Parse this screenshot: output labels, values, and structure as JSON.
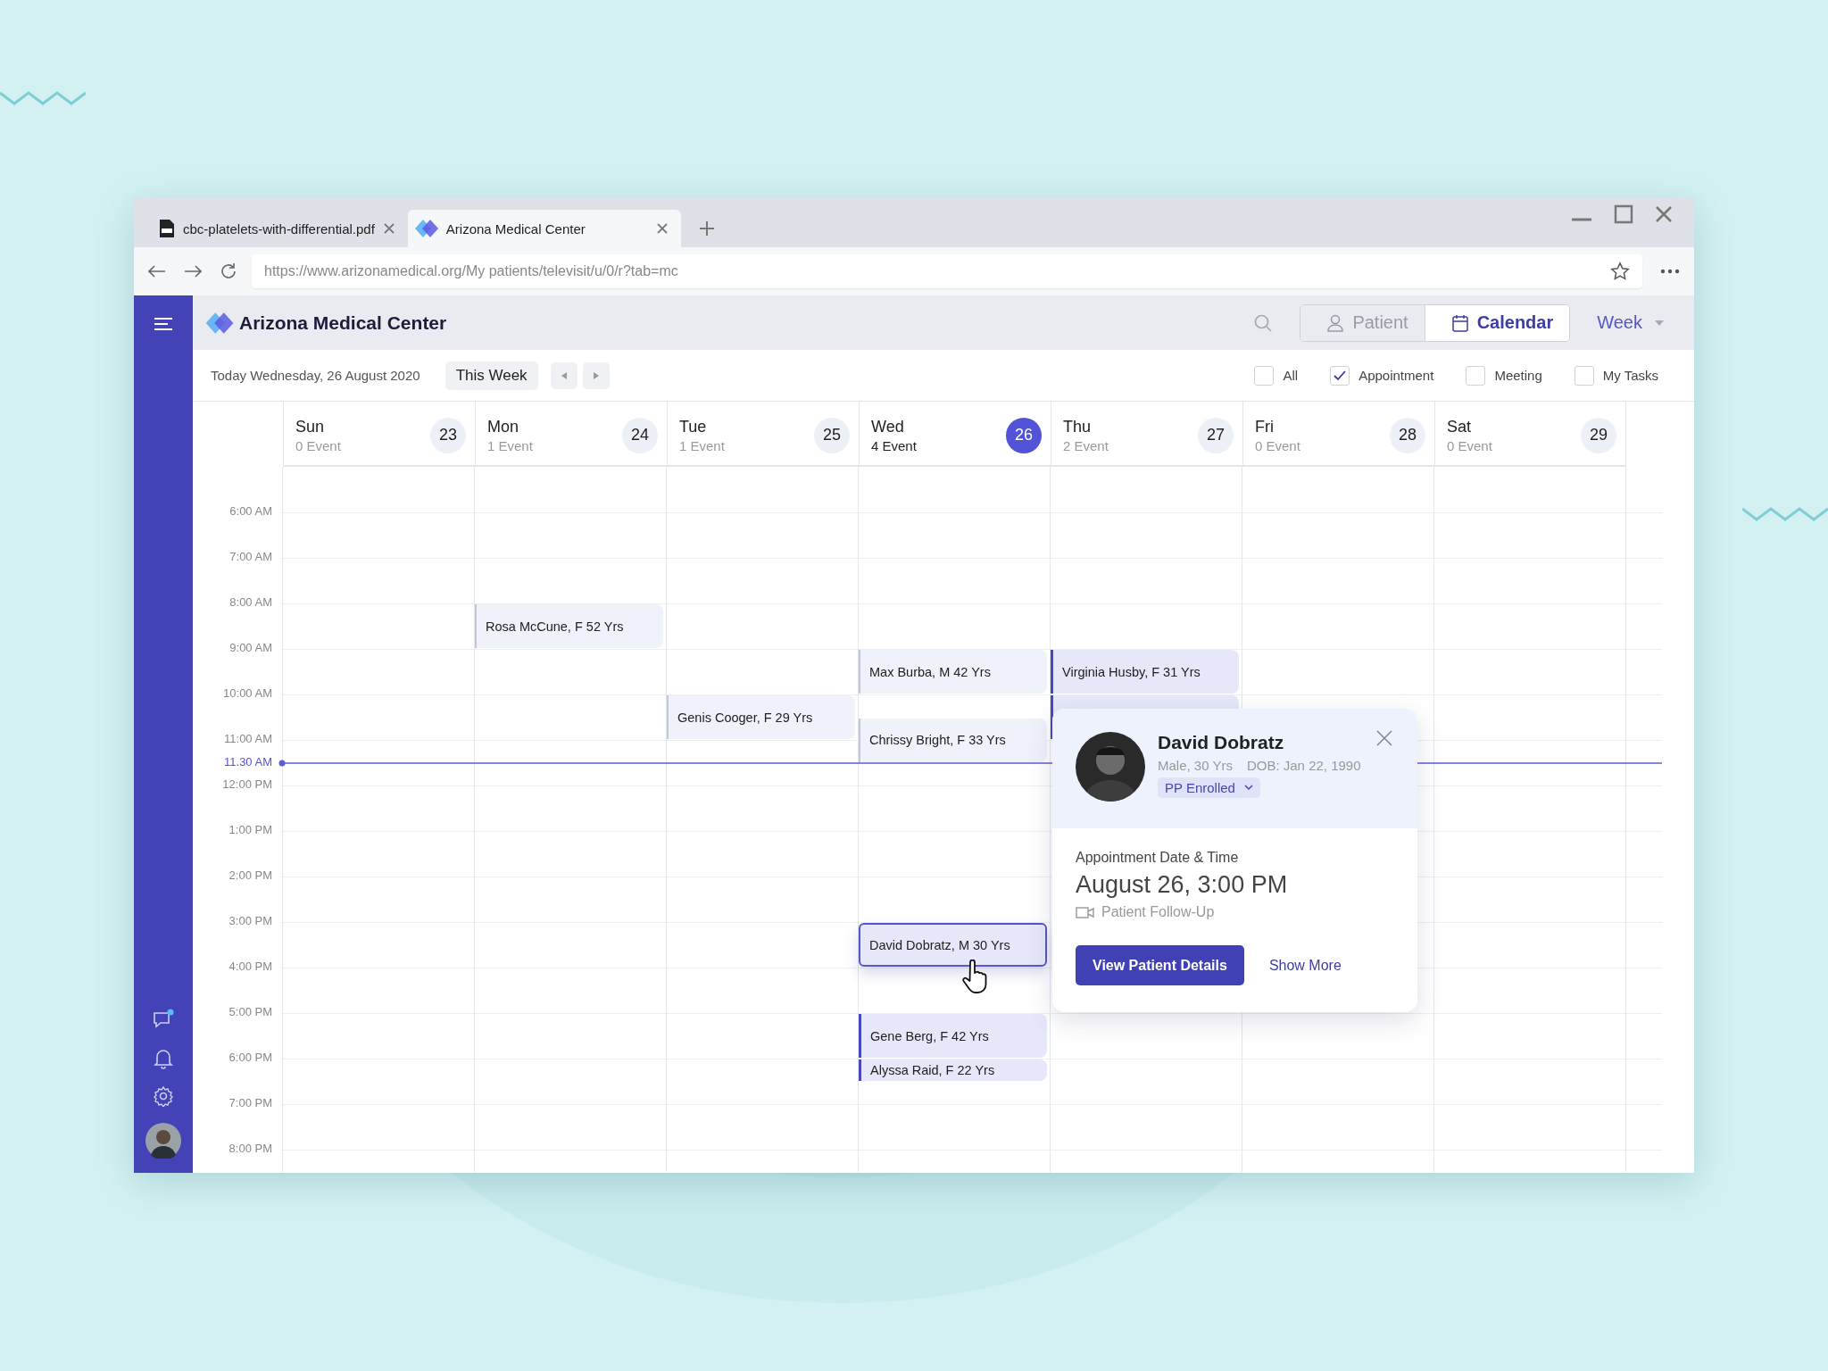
{
  "browser": {
    "tabs": [
      {
        "title": "cbc-platelets-with-differential.pdf",
        "kind": "pdf",
        "selected": false
      },
      {
        "title": "Arizona Medical Center",
        "kind": "site",
        "selected": true
      }
    ],
    "url": "https://www.arizonamedical.org/My patients/televisit/u/0/r?tab=mc"
  },
  "app": {
    "title": "Arizona Medical Center",
    "views": [
      {
        "label": "Patient",
        "kind": "person",
        "selected": false
      },
      {
        "label": "Calendar",
        "kind": "calendar",
        "selected": true
      }
    ],
    "range": "Week"
  },
  "sidebar": {
    "unread_messages": true
  },
  "toolbar": {
    "today": "Today Wednesday, 26 August 2020",
    "this_week": "This Week",
    "filters": [
      {
        "label": "All",
        "checked": false
      },
      {
        "label": "Appointment",
        "checked": true
      },
      {
        "label": "Meeting",
        "checked": false
      },
      {
        "label": "My Tasks",
        "checked": false
      }
    ]
  },
  "days": [
    {
      "name": "Sun",
      "count": "0 Event",
      "date": "23",
      "today": false
    },
    {
      "name": "Mon",
      "count": "1 Event",
      "date": "24",
      "today": false
    },
    {
      "name": "Tue",
      "count": "1 Event",
      "date": "25",
      "today": false
    },
    {
      "name": "Wed",
      "count": "4 Event",
      "date": "26",
      "today": true
    },
    {
      "name": "Thu",
      "count": "2 Event",
      "date": "27",
      "today": false
    },
    {
      "name": "Fri",
      "count": "0 Event",
      "date": "28",
      "today": false
    },
    {
      "name": "Sat",
      "count": "0 Event",
      "date": "29",
      "today": false
    }
  ],
  "hours": [
    {
      "time": "6:00 AM",
      "cells": [
        null,
        null,
        null,
        null,
        null,
        null,
        null
      ]
    },
    {
      "time": "7:00 AM",
      "cells": [
        null,
        null,
        null,
        null,
        null,
        null,
        null
      ]
    },
    {
      "time": "8:00 AM",
      "cells": [
        null,
        {
          "label": "Rosa McCune, F 52 Yrs",
          "kind": "full",
          "past": true,
          "selected": false
        },
        null,
        null,
        null,
        null,
        null
      ]
    },
    {
      "time": "9:00 AM",
      "cells": [
        null,
        null,
        null,
        {
          "label": "Max Burba, M 42 Yrs",
          "kind": "full",
          "past": true,
          "selected": false
        },
        {
          "label": "Virginia Husby, F 31 Yrs",
          "kind": "full",
          "past": false,
          "selected": false
        },
        null,
        null
      ]
    },
    {
      "time": "10:00 AM",
      "cells": [
        null,
        null,
        {
          "label": "Genis Cooger, F 29 Yrs",
          "kind": "full",
          "past": true,
          "selected": false
        },
        {
          "label": "Chrissy Bright, F 33 Yrs",
          "kind": "offset",
          "past": true,
          "selected": false
        },
        {
          "kind": "full",
          "past": false,
          "selected": false
        },
        null,
        null
      ]
    },
    {
      "time": "11:00 AM",
      "cells": [
        null,
        null,
        null,
        null,
        null,
        null,
        null
      ]
    },
    {
      "time": "12:00 PM",
      "cells": [
        null,
        null,
        null,
        null,
        null,
        null,
        null
      ]
    },
    {
      "time": "1:00 PM",
      "cells": [
        null,
        null,
        null,
        null,
        null,
        null,
        null
      ]
    },
    {
      "time": "2:00 PM",
      "cells": [
        null,
        null,
        null,
        null,
        null,
        null,
        null
      ]
    },
    {
      "time": "3:00 PM",
      "cells": [
        null,
        null,
        null,
        {
          "label": "David Dobratz, M 30 Yrs",
          "kind": "full",
          "past": false,
          "selected": true
        },
        null,
        null,
        null
      ]
    },
    {
      "time": "4:00 PM",
      "cells": [
        null,
        null,
        null,
        null,
        null,
        null,
        null
      ]
    },
    {
      "time": "5:00 PM",
      "cells": [
        null,
        null,
        null,
        {
          "label": "Gene Berg, F 42 Yrs",
          "kind": "full",
          "past": false,
          "selected": false
        },
        null,
        null,
        null
      ]
    },
    {
      "time": "6:00 PM",
      "cells": [
        null,
        null,
        null,
        {
          "label": "Alyssa Raid, F 22 Yrs",
          "kind": "short",
          "past": false,
          "selected": false
        },
        null,
        null,
        null
      ]
    },
    {
      "time": "7:00 PM",
      "cells": [
        null,
        null,
        null,
        null,
        null,
        null,
        null
      ]
    },
    {
      "time": "8:00 PM",
      "cells": [
        null,
        null,
        null,
        null,
        null,
        null,
        null
      ]
    }
  ],
  "now": {
    "label": "11.30 AM"
  },
  "popup": {
    "name": "David Dobratz",
    "details": "Male, 30 Yrs",
    "dob": "DOB: Jan 22, 1990",
    "badge": "PP Enrolled",
    "section": "Appointment Date & Time",
    "datetime": "August 26, 3:00 PM",
    "type": "Patient Follow-Up",
    "primary": "View Patient Details",
    "secondary": "Show More"
  }
}
